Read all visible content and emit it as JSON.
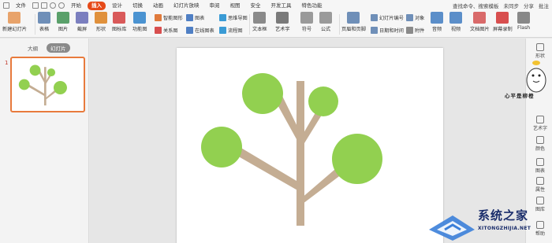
{
  "menubar": {
    "file": "文件",
    "tabs": [
      "开始",
      "插入",
      "设计",
      "切换",
      "动画",
      "幻灯片放映",
      "审阅",
      "视图",
      "安全",
      "开发工具",
      "特色功能"
    ],
    "active_tab": "插入",
    "search": "查找命令、搜索模板",
    "sync": "未同步",
    "share": "分享",
    "comment": "批注"
  },
  "ribbon": {
    "new_slide": "新建幻灯片",
    "table": "表格",
    "picture": "图片",
    "screenshot": "截屏",
    "shape": "形状",
    "icon_lib": "图标库",
    "func_chart": "功能图",
    "smart_graphic": "智能图形",
    "chart": "图表",
    "mind_map": "思维导图",
    "relation": "关系图",
    "online_chart": "在线图表",
    "flow_chart": "流程图",
    "textbox": "文本框",
    "art_text": "艺术字",
    "symbol": "符号",
    "formula": "公式",
    "header_footer": "页眉和页脚",
    "slide_number": "幻灯片编号",
    "datetime": "日期和时间",
    "object": "对象",
    "attachment": "附件",
    "audio": "音频",
    "video": "视频",
    "doc_image": "文档图片",
    "screen_record": "屏幕录制",
    "flash": "Flash"
  },
  "left_panel": {
    "tab_outline": "大纲",
    "tab_slides": "幻灯片",
    "slide_number": "1"
  },
  "right_bar": {
    "items": [
      "形状",
      "艺术字",
      "颜色",
      "图表",
      "属性",
      "图库",
      "帮助"
    ]
  },
  "sticker": {
    "text": "心平是柳橙"
  },
  "watermark": {
    "title": "系统之家",
    "url": "XITONGZHIJIA.NET"
  },
  "colors": {
    "leaf": "#92d050",
    "branch": "#c4ad93",
    "accent": "#e64a19"
  }
}
